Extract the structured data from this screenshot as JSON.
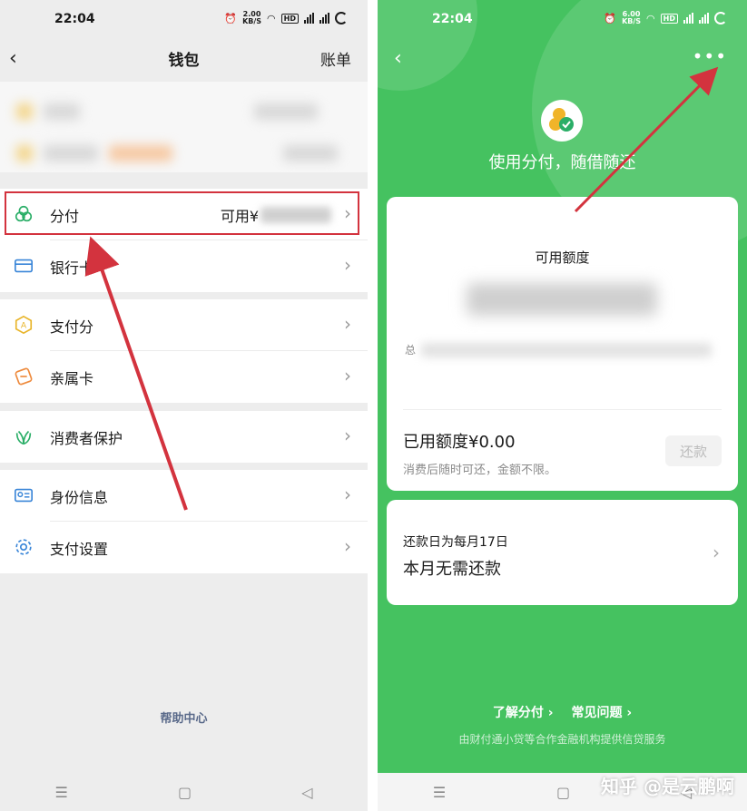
{
  "left": {
    "status": {
      "time": "22:04",
      "speed": "2.00",
      "speed_unit": "KB/S"
    },
    "nav": {
      "title": "钱包",
      "bill": "账单"
    },
    "menu": [
      {
        "label": "分付",
        "extra": "可用¥"
      },
      {
        "label": "银行卡"
      },
      {
        "label": "支付分"
      },
      {
        "label": "亲属卡"
      },
      {
        "label": "消费者保护"
      },
      {
        "label": "身份信息"
      },
      {
        "label": "支付设置"
      }
    ],
    "help": "帮助中心"
  },
  "right": {
    "status": {
      "time": "22:04",
      "speed": "6.00",
      "speed_unit": "KB/S"
    },
    "slogan": "使用分付，随借随还",
    "available_label": "可用额度",
    "total_prefix": "总",
    "used": "已用额度¥0.00",
    "used_sub": "消费后随时可还，金额不限。",
    "repay_button": "还款",
    "due_day": "还款日为每月17日",
    "due_status": "本月无需还款",
    "link_learn": "了解分付 ›",
    "link_faq": "常见问题 ›",
    "disclaimer": "由财付通小贷等合作金融机构提供信贷服务",
    "watermark": "知乎 @是云鹏啊"
  },
  "colors": {
    "brand_green": "#45c260",
    "annotation_red": "#d3333e"
  }
}
